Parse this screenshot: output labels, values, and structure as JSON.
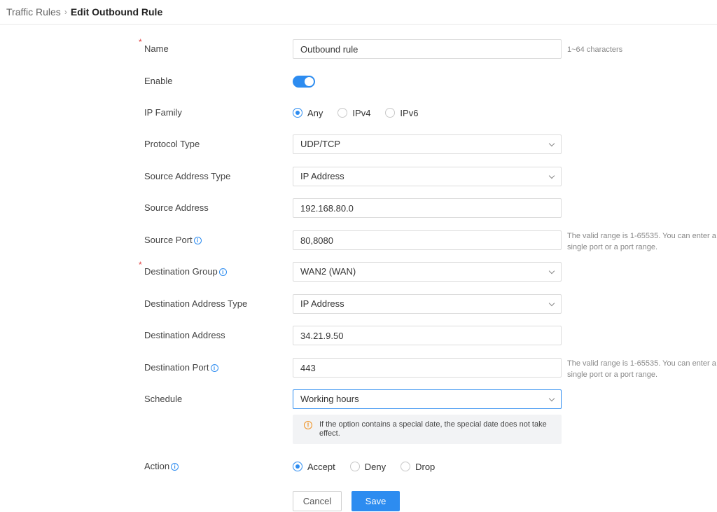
{
  "breadcrumb": {
    "parent": "Traffic Rules",
    "current": "Edit Outbound Rule"
  },
  "form": {
    "name": {
      "label": "Name",
      "value": "Outbound rule",
      "hint": "1~64 characters"
    },
    "enable": {
      "label": "Enable",
      "on": true
    },
    "ip_family": {
      "label": "IP Family",
      "options": [
        "Any",
        "IPv4",
        "IPv6"
      ],
      "selected": "Any"
    },
    "protocol_type": {
      "label": "Protocol Type",
      "value": "UDP/TCP"
    },
    "source_address_type": {
      "label": "Source Address Type",
      "value": "IP Address"
    },
    "source_address": {
      "label": "Source Address",
      "value": "192.168.80.0"
    },
    "source_port": {
      "label": "Source Port",
      "value": "80,8080",
      "hint": "The valid range is 1-65535. You can enter a single port or a port range."
    },
    "destination_group": {
      "label": "Destination Group",
      "value": "WAN2 (WAN)"
    },
    "destination_address_type": {
      "label": "Destination Address Type",
      "value": "IP Address"
    },
    "destination_address": {
      "label": "Destination Address",
      "value": "34.21.9.50"
    },
    "destination_port": {
      "label": "Destination Port",
      "value": "443",
      "hint": "The valid range is 1-65535. You can enter a single port or a port range."
    },
    "schedule": {
      "label": "Schedule",
      "value": "Working hours",
      "notice": "If the option contains a special date, the special date does not take effect."
    },
    "action": {
      "label": "Action",
      "options": [
        "Accept",
        "Deny",
        "Drop"
      ],
      "selected": "Accept"
    }
  },
  "buttons": {
    "cancel": "Cancel",
    "save": "Save"
  },
  "icons": {
    "info": "info-icon",
    "warning": "warning-icon",
    "chevron": "chevron-down-icon",
    "breadcrumb_sep": "chevron-right-icon"
  },
  "colors": {
    "accent": "#2d8cf0",
    "required": "#e04040",
    "warning": "#f0901e"
  }
}
